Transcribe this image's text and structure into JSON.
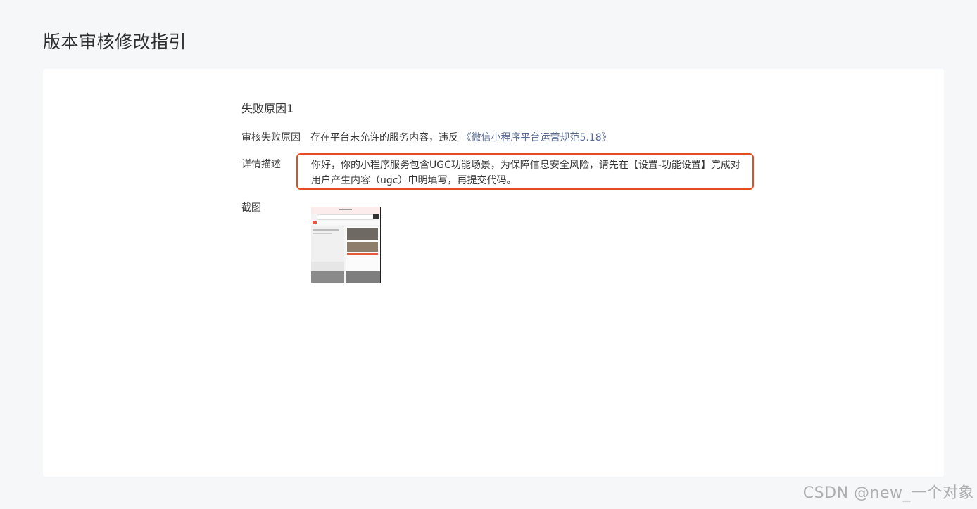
{
  "page": {
    "title": "版本审核修改指引"
  },
  "failure": {
    "section_title": "失败原因1",
    "reason_label": "审核失败原因",
    "reason_text": "存在平台未允许的服务内容，违反 ",
    "reason_link": "《微信小程序平台运营规范5.18》",
    "detail_label": "详情描述",
    "detail_line1": "你好，你的小程序服务包含UGC功能场景，为保障信息安全风险，请先在【设置-功能设置】完成对",
    "detail_line2": "用户产生内容（ugc）申明填写，再提交代码。",
    "screenshot_label": "截图"
  },
  "watermark": {
    "text": "CSDN @new_一个对象"
  },
  "colors": {
    "link": "#576b95",
    "highlight_border": "#e34d22",
    "background": "#f6f7f9",
    "card": "#ffffff"
  }
}
